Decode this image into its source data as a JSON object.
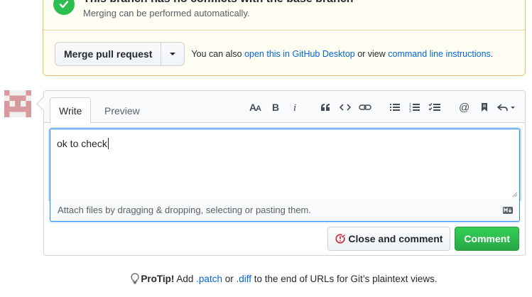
{
  "merge": {
    "status_title": "This branch has no conflicts with the base branch",
    "status_subtitle": "Merging can be performed automatically.",
    "merge_button": "Merge pull request",
    "note_prefix": "You can also ",
    "note_link_desktop": "open this in GitHub Desktop",
    "note_middle": " or view ",
    "note_link_cli": "command line instructions",
    "note_suffix": "."
  },
  "comment": {
    "tabs": {
      "write": "Write",
      "preview": "Preview"
    },
    "toolbar_icons": [
      "text-size-icon",
      "bold-icon",
      "italic-icon",
      "quote-icon",
      "code-icon",
      "link-icon",
      "bulleted-list-icon",
      "numbered-list-icon",
      "task-list-icon",
      "mention-icon",
      "saved-reply-icon",
      "reply-icon"
    ],
    "text_value": "ok to check",
    "attach_hint": "Attach files by dragging & dropping, selecting or pasting them.",
    "close_button": "Close and comment",
    "comment_button": "Comment"
  },
  "protip": {
    "label": "ProTip!",
    "text1": " Add ",
    "patch": ".patch",
    "text2": " or ",
    "diff": ".diff",
    "text3": " to the end of URLs for Git’s plaintext views."
  },
  "colors": {
    "accent_link": "#0366d6",
    "success_green": "#28a745",
    "focus_blue": "#2188ff",
    "close_red": "#cb2431"
  }
}
